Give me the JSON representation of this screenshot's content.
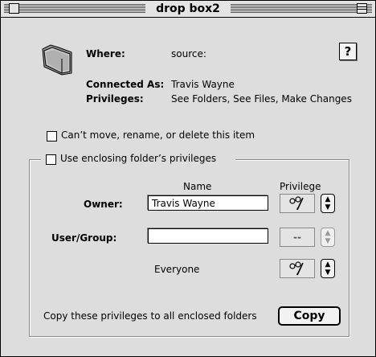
{
  "window": {
    "title": "drop box2"
  },
  "info": {
    "where_label": "Where:",
    "where_value": "source:",
    "connected_label": "Connected As:",
    "connected_value": "Travis Wayne",
    "privileges_label": "Privileges:",
    "privileges_value": "See Folders, See Files, Make Changes"
  },
  "help_label": "?",
  "cant_move_label": "Can’t move, rename, or delete this item",
  "use_enclosing_label": "Use enclosing folder’s privileges",
  "columns": {
    "name": "Name",
    "privilege": "Privilege"
  },
  "owner": {
    "label": "Owner:",
    "value": "Travis Wayne",
    "privilege_icon": "pencil-glasses-icon"
  },
  "user_group": {
    "label": "User/Group:",
    "value": "",
    "privilege_value": "--"
  },
  "everyone": {
    "label": "Everyone",
    "privilege_icon": "pencil-glasses-icon"
  },
  "copy_text": "Copy these privileges to all enclosed folders",
  "copy_button": "Copy"
}
